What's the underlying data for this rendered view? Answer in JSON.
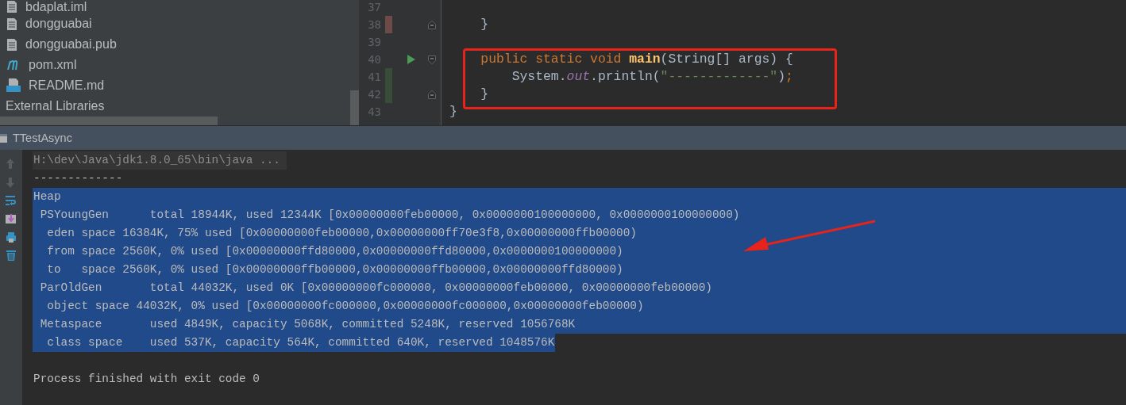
{
  "project_tree": {
    "items": [
      {
        "name": "bdaplat.iml",
        "kind": "module"
      },
      {
        "name": "dongguabai",
        "kind": "file"
      },
      {
        "name": "dongguabai.pub",
        "kind": "file"
      },
      {
        "name": "pom.xml",
        "kind": "maven"
      },
      {
        "name": "README.md",
        "kind": "markdown"
      },
      {
        "name": "External Libraries",
        "kind": "library"
      }
    ]
  },
  "editor": {
    "lines": [
      {
        "number": "37",
        "added": false,
        "deleted": false,
        "fold_start": false,
        "fold_end": false,
        "runnable": false,
        "boxed": false
      },
      {
        "number": "38",
        "added": false,
        "deleted": true,
        "fold_start": false,
        "fold_end": true,
        "runnable": false,
        "boxed": false,
        "tokens": [
          {
            "text": "    }",
            "kind": "plain"
          }
        ]
      },
      {
        "number": "39",
        "added": false,
        "deleted": false,
        "fold_start": false,
        "fold_end": false,
        "runnable": false,
        "boxed": false
      },
      {
        "number": "40",
        "added": false,
        "deleted": false,
        "fold_start": true,
        "fold_end": false,
        "runnable": true,
        "boxed": true,
        "tokens": [
          {
            "text": "    public static void ",
            "kind": "keyword"
          },
          {
            "text": "main",
            "kind": "method"
          },
          {
            "text": "(String[] args) {",
            "kind": "plain"
          }
        ]
      },
      {
        "number": "41",
        "added": true,
        "deleted": false,
        "fold_start": false,
        "fold_end": false,
        "runnable": false,
        "boxed": true,
        "tokens": [
          {
            "text": "        System.",
            "kind": "plain"
          },
          {
            "text": "out",
            "kind": "field"
          },
          {
            "text": ".println(",
            "kind": "plain"
          },
          {
            "text": "\"-------------\"",
            "kind": "string"
          },
          {
            "text": ")",
            "kind": "plain"
          },
          {
            "text": ";",
            "kind": "keyword"
          }
        ]
      },
      {
        "number": "42",
        "added": true,
        "deleted": false,
        "fold_start": false,
        "fold_end": true,
        "runnable": false,
        "boxed": true,
        "tokens": [
          {
            "text": "    }",
            "kind": "plain"
          }
        ]
      },
      {
        "number": "43",
        "added": false,
        "deleted": false,
        "fold_start": false,
        "fold_end": false,
        "runnable": false,
        "boxed": false,
        "tokens": [
          {
            "text": "}",
            "kind": "plain"
          }
        ]
      }
    ]
  },
  "run_panel": {
    "title": "TTestAsync",
    "toolbar": [
      {
        "kind": "up",
        "disabled": true
      },
      {
        "kind": "down",
        "disabled": true
      },
      {
        "kind": "wrap",
        "disabled": false
      },
      {
        "kind": "scroll-end",
        "disabled": false
      },
      {
        "kind": "print",
        "disabled": false
      },
      {
        "kind": "trash",
        "disabled": false
      }
    ],
    "console": [
      {
        "kind": "command",
        "text": "H:\\dev\\Java\\jdk1.8.0_65\\bin\\java ...",
        "selected": false
      },
      {
        "kind": "output",
        "text": "-------------",
        "selected": false
      },
      {
        "kind": "output",
        "text": "Heap",
        "selected": true
      },
      {
        "kind": "output",
        "text": " PSYoungGen      total 18944K, used 12344K [0x00000000feb00000, 0x0000000100000000, 0x0000000100000000)",
        "selected": true
      },
      {
        "kind": "output",
        "text": "  eden space 16384K, 75% used [0x00000000feb00000,0x00000000ff70e3f8,0x00000000ffb00000)",
        "selected": true
      },
      {
        "kind": "output",
        "text": "  from space 2560K, 0% used [0x00000000ffd80000,0x00000000ffd80000,0x0000000100000000)",
        "selected": true
      },
      {
        "kind": "output",
        "text": "  to   space 2560K, 0% used [0x00000000ffb00000,0x00000000ffb00000,0x00000000ffd80000)",
        "selected": true
      },
      {
        "kind": "output",
        "text": " ParOldGen       total 44032K, used 0K [0x00000000fc000000, 0x00000000feb00000, 0x00000000feb00000)",
        "selected": true
      },
      {
        "kind": "output",
        "text": "  object space 44032K, 0% used [0x00000000fc000000,0x00000000fc000000,0x00000000feb00000)",
        "selected": true
      },
      {
        "kind": "output",
        "text": " Metaspace       used 4849K, capacity 5068K, committed 5248K, reserved 1056768K",
        "selected": true
      },
      {
        "kind": "output",
        "text": "  class space    used 537K, capacity 564K, committed 640K, reserved 1048576K",
        "selected": true
      },
      {
        "kind": "status",
        "text": "Process finished with exit code 0",
        "selected": false
      }
    ],
    "annotations": [
      {
        "kind": "arrow"
      }
    ]
  }
}
